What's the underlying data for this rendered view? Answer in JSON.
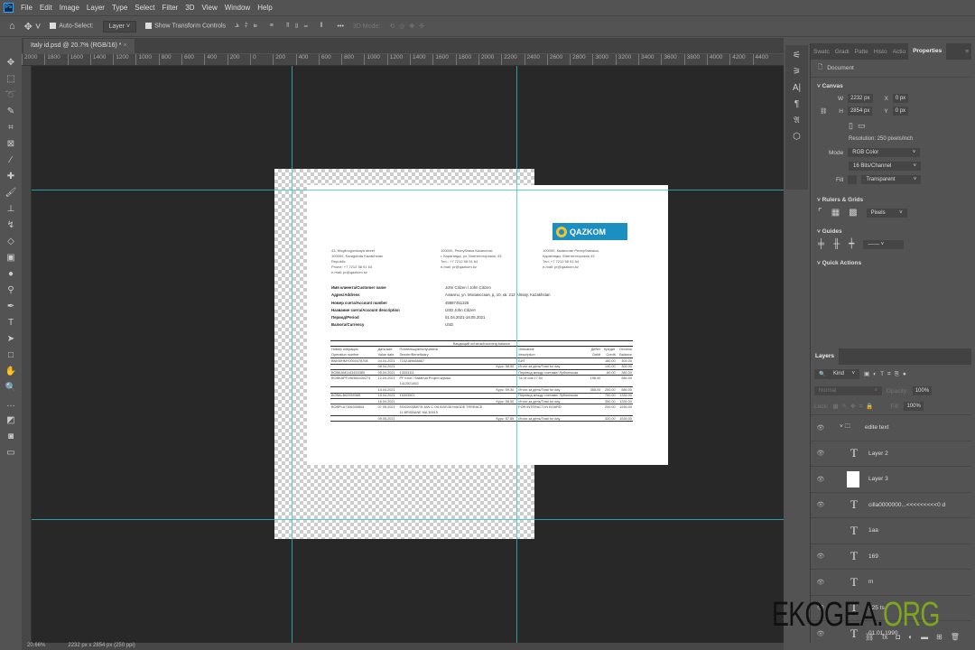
{
  "menu": {
    "items": [
      "File",
      "Edit",
      "Image",
      "Layer",
      "Type",
      "Select",
      "Filter",
      "3D",
      "View",
      "Window",
      "Help"
    ]
  },
  "options": {
    "auto_select": "Auto-Select:",
    "layer_select": "Layer",
    "show_transform": "Show Transform Controls",
    "mode_3d": "3D Mode:",
    "more": "•••"
  },
  "document_tab": {
    "title": "Italy id.psd @ 20.7% (RGB/16) *",
    "close": "×"
  },
  "ruler": {
    "h_ticks": [
      "2000",
      "1800",
      "1600",
      "1400",
      "1200",
      "1000",
      "800",
      "600",
      "400",
      "200",
      "0",
      "200",
      "400",
      "600",
      "800",
      "1000",
      "1200",
      "1400",
      "1600",
      "1800",
      "2000",
      "2200",
      "2400",
      "2600",
      "2800",
      "3000",
      "3200",
      "3400",
      "3600",
      "3800",
      "4000",
      "4200",
      "4400"
    ]
  },
  "statement": {
    "logo": "QAZKOM",
    "addresses": [
      [
        "43, Mogilnogorskaya street",
        "100000, Karaganda Kazakhstan",
        "Republic",
        "Phone: +7 7212 58 91 64",
        "e-mail: pr@qazkom.kz"
      ],
      [
        "100000, Республика Казахстан,",
        "г. Караганда, ул. Магнитогорская, 43",
        "Тел.: +7 7212 58 91 64",
        "e-mail: pr@qazkom.kz"
      ],
      [
        "100000, Казахстан Республикасы,",
        "Қарағанды, Магнитогорская 43",
        "Тел: +7 7212 58 91 64",
        "e-mail: pr@qazkom.kz"
      ]
    ],
    "info": [
      {
        "label": "Имя клиента/Customer name",
        "value": "John Citizen / John Citizen"
      },
      {
        "label": "Адрес/Address",
        "value": "Алматы, ул. Мосмисская, д. 10, кв. 212 Almaty, Kazakhstan"
      },
      {
        "label": "Номер счета/Account number",
        "value": "45887451325"
      },
      {
        "label": "Название счета/Account description",
        "value": "USD John Citizen"
      },
      {
        "label": "Период/Period",
        "value": "01.04.2021-18.05.2021"
      },
      {
        "label": "Валюта/Currency",
        "value": "USD"
      }
    ],
    "table_caption": "Входящий остаток/Incoming balance",
    "headers": [
      [
        "Номер операции",
        "Operation number"
      ],
      [
        "Дата вал.",
        "Value date"
      ],
      [
        "Плательщик/получатель",
        "Sender/Beneficiary"
      ],
      [
        "",
        ""
      ],
      [
        "Описание",
        "description"
      ],
      [
        "Дебет",
        "Debit"
      ],
      [
        "Кредит",
        "Credit"
      ],
      [
        "Остаток",
        "Balance"
      ]
    ],
    "rows": [
      [
        "BNKMHMY0000478708",
        "04.04.2021",
        "7152189668867",
        "",
        "БИТ",
        "",
        "160.00",
        "300.00"
      ],
      [
        "",
        "08.04.2021",
        "",
        "Курс: 58.50",
        "Итоги за день/Total for day",
        "",
        "140.00",
        "300.00"
      ],
      [
        "BOBKAM1143453385",
        "05.04.2021",
        "13003111",
        "",
        "Перевод между счетами/ Лубнинская",
        "",
        "-80.00",
        "380.00"
      ],
      [
        "BOBKAPF196384430274",
        "12.04.2021",
        "PF fund / Sallamat Project жумыс",
        "",
        "Та от сов 17.50",
        "198.00",
        "",
        "580.00"
      ],
      [
        "",
        "",
        "1412521452",
        "",
        "",
        "",
        "",
        ""
      ],
      [
        "",
        "14.04.2021",
        "",
        "Курс: 59.30",
        "Итоги за день/Total for day",
        "358.00",
        "250.00",
        "580.00"
      ],
      [
        "BOBALB62559385",
        "15.04.2021",
        "15303001",
        "",
        "Перевод между счетами/ Лубнинская",
        "",
        "750.00",
        "1330.00"
      ],
      [
        "",
        "18.04.2021",
        "",
        "Курс: 58.50",
        "Итоги за день/Total for day",
        "",
        "350.00",
        "1330.00"
      ],
      [
        "BOBPLA7166330804",
        "07.05.2021",
        "SSK0000887/5 JAN C O6 AGE/38 MAGDE TERRACE",
        "",
        "FOR INTERACT IN BOARD",
        "",
        "200.00",
        "1530.00"
      ],
      [
        "",
        "",
        "11 BRISBANE MA 30915",
        "",
        "",
        "",
        "",
        ""
      ],
      [
        "",
        "09.05.2021",
        "",
        "Курс: 57.85",
        "Итоги за день/Total for day",
        "",
        "320.00",
        "1530.00"
      ]
    ]
  },
  "properties": {
    "tabs": [
      "Swatc",
      "Gradi",
      "Patte",
      "Histo",
      "Actio",
      "Properties"
    ],
    "document_label": "Document",
    "canvas_title": "Canvas",
    "w_label": "W",
    "w_value": "2232 px",
    "h_label": "H",
    "h_value": "2854 px",
    "x_label": "X",
    "x_value": "0 px",
    "y_label": "Y",
    "y_value": "0 px",
    "resolution": "Resolution: 250 pixels/inch",
    "mode_label": "Mode",
    "mode_value": "RGB Color",
    "depth_value": "16 Bits/Channel",
    "fill_label": "Fill",
    "fill_value": "Transparent",
    "rulers_title": "Rulers & Grids",
    "units_value": "Pixels",
    "guides_title": "Guides",
    "quick_actions": "Quick Actions"
  },
  "layers": {
    "title": "Layers",
    "kind": "Kind",
    "blend": "Normal",
    "opacity_label": "Opacity:",
    "opacity_value": "100%",
    "lock_label": "Lock:",
    "fill_label": "Fill:",
    "fill_value": "100%",
    "items": [
      {
        "name": "edite text",
        "type": "group"
      },
      {
        "name": "Layer 2",
        "type": "text"
      },
      {
        "name": "Layer 3",
        "type": "image"
      },
      {
        "name": "cilla0000000...<<<<<<<<<0 d",
        "type": "text"
      },
      {
        "name": "1aa",
        "type": "text"
      },
      {
        "name": "169",
        "type": "text"
      },
      {
        "name": "m",
        "type": "text"
      },
      {
        "name": "125 ts",
        "type": "text"
      },
      {
        "name": "01.01.1990",
        "type": "text"
      }
    ]
  },
  "status": {
    "zoom": "20.66%",
    "doc_size": "2232 px x 2854 px (250 ppi)"
  },
  "watermark": {
    "main": "EKOGEA.",
    "accent": "ORG"
  }
}
